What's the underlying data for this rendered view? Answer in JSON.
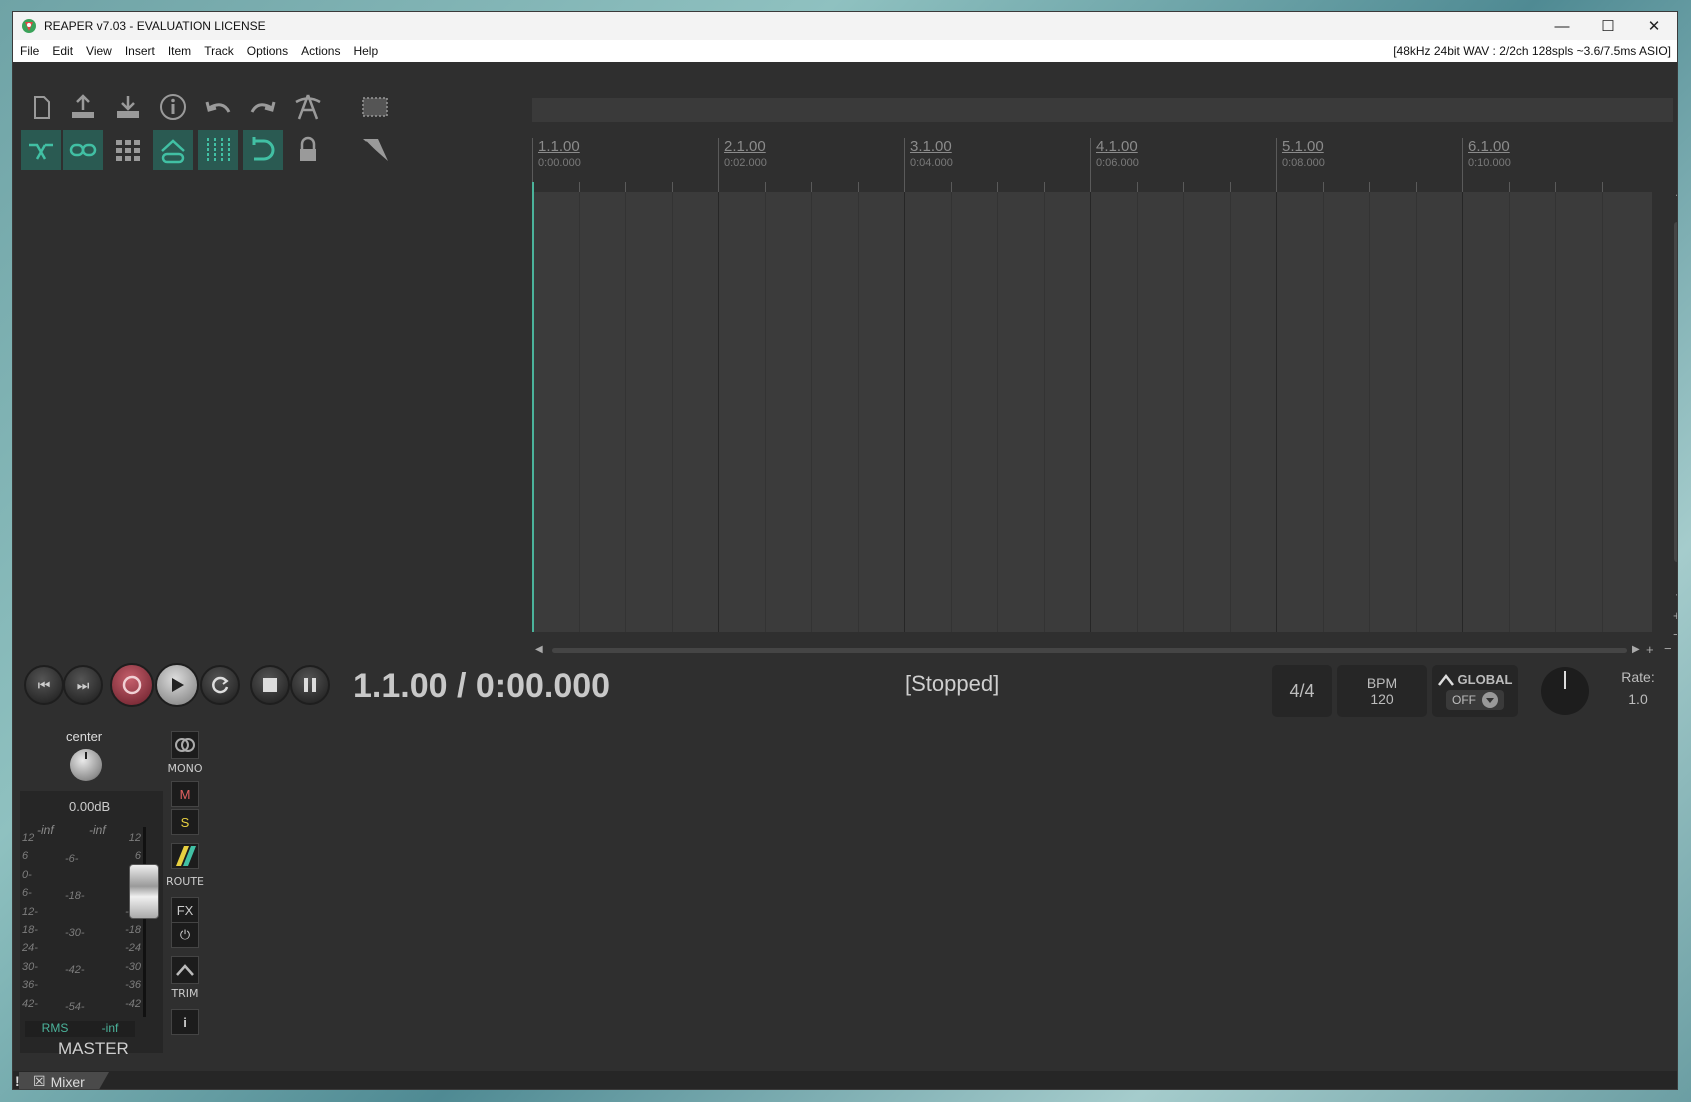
{
  "window": {
    "title": "REAPER v7.03 - EVALUATION LICENSE",
    "minimize_icon": "minimize-icon",
    "maximize_icon": "maximize-icon",
    "close_icon": "close-icon"
  },
  "menubar": {
    "items": [
      "File",
      "Edit",
      "View",
      "Insert",
      "Item",
      "Track",
      "Options",
      "Actions",
      "Help"
    ],
    "status": "[48kHz 24bit WAV : 2/2ch 128spls ~3.6/7.5ms ASIO]"
  },
  "toolbar": {
    "row1": [
      "new-project-icon",
      "open-project-icon",
      "save-project-icon",
      "project-settings-icon",
      "undo-icon",
      "redo-icon",
      "metronome-icon",
      "selection-box-icon"
    ],
    "row2": [
      "ripple-edit-icon",
      "item-grouping-icon",
      "grid-icon",
      "envelope-link-icon",
      "snap-grid-icon",
      "loop-points-icon",
      "lock-icon",
      "trim-behind-icon"
    ]
  },
  "ruler": {
    "marks": [
      {
        "bar": "1.1.00",
        "time": "0:00.000"
      },
      {
        "bar": "2.1.00",
        "time": "0:02.000"
      },
      {
        "bar": "3.1.00",
        "time": "0:04.000"
      },
      {
        "bar": "4.1.00",
        "time": "0:06.000"
      },
      {
        "bar": "5.1.00",
        "time": "0:08.000"
      },
      {
        "bar": "6.1.00",
        "time": "0:10.000"
      }
    ]
  },
  "transport": {
    "position": "1.1.00 / 0:00.000",
    "state": "[Stopped]",
    "time_signature": "4/4",
    "bpm_label": "BPM",
    "bpm_value": "120",
    "global_label": "GLOBAL",
    "global_value": "OFF",
    "rate_label": "Rate:",
    "rate_value": "1.0",
    "buttons": [
      "go-to-start-icon",
      "go-to-end-icon",
      "record-icon",
      "play-icon",
      "repeat-icon",
      "stop-icon",
      "pause-icon"
    ]
  },
  "mixer": {
    "pan_label": "center",
    "volume": "0.00dB",
    "peak_left": "-inf",
    "peak_right": "-inf",
    "scale_left": [
      "12",
      "6",
      "0-",
      "6-",
      "12-",
      "18-",
      "24-",
      "30-",
      "36-",
      "42-"
    ],
    "scale_mid": [
      "-6-",
      "-18-",
      "-30-",
      "-42-",
      "-54-"
    ],
    "scale_right": [
      "12",
      "6",
      "-0",
      "-6",
      "-12",
      "-18",
      "-24",
      "-30",
      "-36",
      "-42"
    ],
    "rms_label": "RMS",
    "rms_value": "-inf",
    "track_name": "MASTER",
    "mono_label": "MONO",
    "mute_label": "M",
    "solo_label": "S",
    "route_label": "ROUTE",
    "fx_label": "FX",
    "trim_label": "TRIM",
    "info_label": "i",
    "tab_label": "Mixer",
    "tab_bang": "!",
    "colors": {
      "accent": "#4bb39b",
      "mute": "#e06060",
      "solo": "#e8d040"
    }
  }
}
